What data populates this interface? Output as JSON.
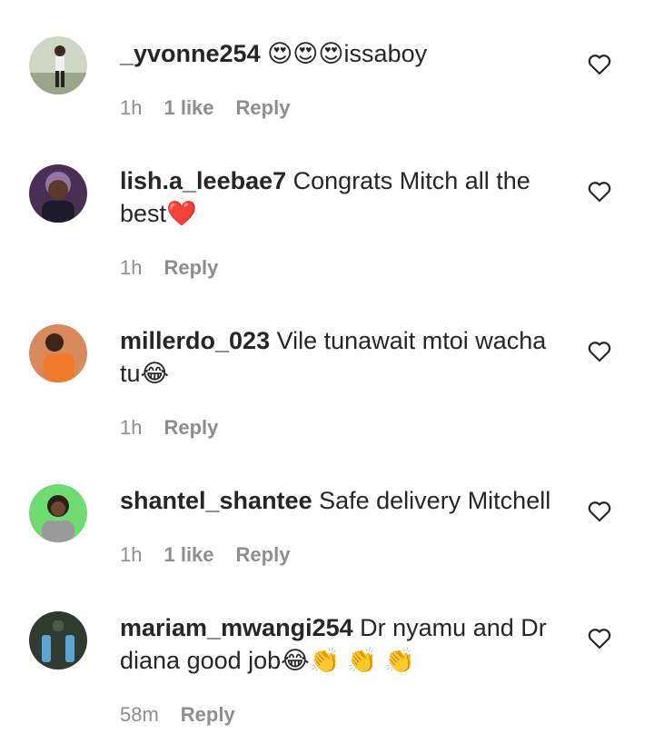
{
  "comments": [
    {
      "username": "_yvonne254",
      "text": "😍😍😍issaboy",
      "time": "1h",
      "likes": "1 like",
      "reply": "Reply",
      "avatar_color": "#cfd6c4"
    },
    {
      "username": "lish.a_leebae7",
      "text": "Congrats Mitch all the best❤️",
      "time": "1h",
      "likes": "",
      "reply": "Reply",
      "avatar_color": "#6a3b6e"
    },
    {
      "username": "millerdo_023",
      "text": "Vile tunawait mtoi wacha tu😂",
      "time": "1h",
      "likes": "",
      "reply": "Reply",
      "avatar_color": "#e07a3a"
    },
    {
      "username": "shantel_shantee",
      "text": "Safe delivery Mitchell",
      "time": "1h",
      "likes": "1 like",
      "reply": "Reply",
      "avatar_color": "#6fdc6f"
    },
    {
      "username": "mariam_mwangi254",
      "text": "Dr nyamu and Dr diana good job😂👏 👏 👏",
      "time": "58m",
      "likes": "",
      "reply": "Reply",
      "avatar_color": "#2f3b2e"
    }
  ]
}
